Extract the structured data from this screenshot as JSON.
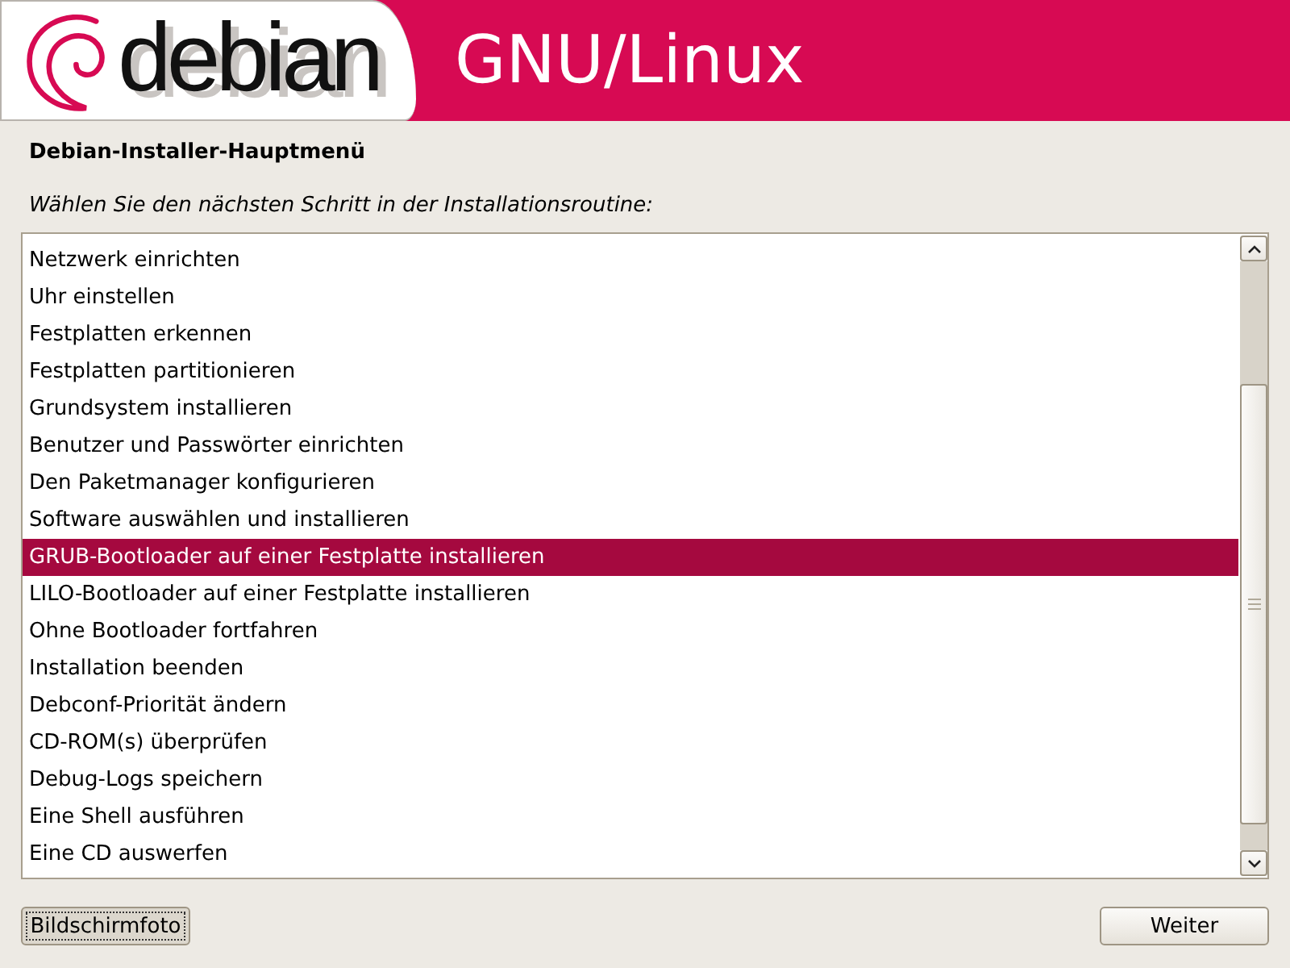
{
  "header": {
    "logo_text": "debian",
    "title": "GNU/Linux"
  },
  "dialog": {
    "title": "Debian-Installer-Hauptmenü",
    "prompt": "Wählen Sie den nächsten Schritt in der Installationsroutine:"
  },
  "menu": {
    "items": [
      {
        "label": "Netzwerk einrichten",
        "selected": false
      },
      {
        "label": "Uhr einstellen",
        "selected": false
      },
      {
        "label": "Festplatten erkennen",
        "selected": false
      },
      {
        "label": "Festplatten partitionieren",
        "selected": false
      },
      {
        "label": "Grundsystem installieren",
        "selected": false
      },
      {
        "label": "Benutzer und Passwörter einrichten",
        "selected": false
      },
      {
        "label": "Den Paketmanager konfigurieren",
        "selected": false
      },
      {
        "label": "Software auswählen und installieren",
        "selected": false
      },
      {
        "label": "GRUB-Bootloader auf einer Festplatte installieren",
        "selected": true
      },
      {
        "label": "LILO-Bootloader auf einer Festplatte installieren",
        "selected": false
      },
      {
        "label": "Ohne Bootloader fortfahren",
        "selected": false
      },
      {
        "label": "Installation beenden",
        "selected": false
      },
      {
        "label": "Debconf-Priorität ändern",
        "selected": false
      },
      {
        "label": "CD-ROM(s) überprüfen",
        "selected": false
      },
      {
        "label": "Debug-Logs speichern",
        "selected": false
      },
      {
        "label": "Eine Shell ausführen",
        "selected": false
      },
      {
        "label": "Eine CD auswerfen",
        "selected": false
      }
    ]
  },
  "buttons": [
    {
      "label": "Bildschirmfoto",
      "focused": true
    },
    {
      "label": "Weiter",
      "focused": false
    }
  ]
}
